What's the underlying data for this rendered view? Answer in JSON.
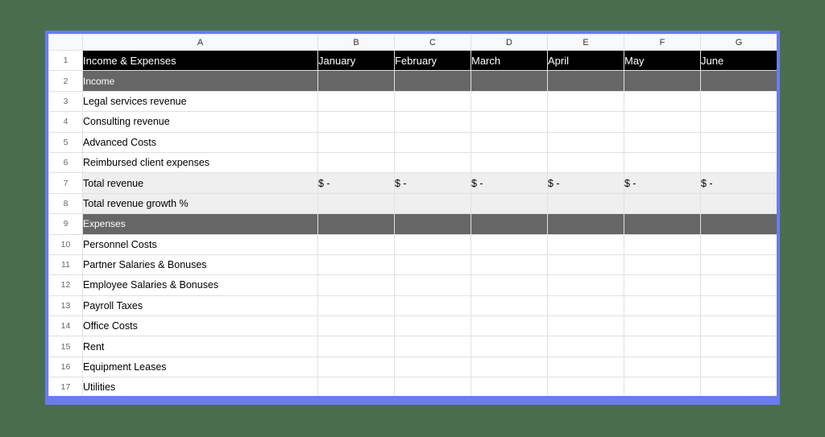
{
  "app": {
    "background_color": "#4a6e4d",
    "frame_border_color": "#6b7bf0"
  },
  "spreadsheet": {
    "column_headers": [
      "A",
      "B",
      "C",
      "D",
      "E",
      "F",
      "G"
    ],
    "corner_label": "",
    "colors": {
      "title_row_bg": "#000000",
      "section_row_bg": "#666666",
      "total_row_bg": "#efefef",
      "gridline": "#e0e0e3",
      "header_strip_bg": "#f8f9fa"
    },
    "months": [
      "January",
      "February",
      "March",
      "April",
      "May",
      "June"
    ],
    "rows": [
      {
        "num": "1",
        "label": "Income & Expenses",
        "style": "title",
        "merged": false,
        "values": [
          "January",
          "February",
          "March",
          "April",
          "May",
          "June"
        ]
      },
      {
        "num": "2",
        "label": "Income",
        "style": "section",
        "merged": true,
        "values": [
          "",
          "",
          "",
          "",
          "",
          ""
        ]
      },
      {
        "num": "3",
        "label": "Legal services revenue",
        "style": "normal",
        "merged": false,
        "values": [
          "",
          "",
          "",
          "",
          "",
          ""
        ]
      },
      {
        "num": "4",
        "label": "Consulting revenue",
        "style": "normal",
        "merged": false,
        "values": [
          "",
          "",
          "",
          "",
          "",
          ""
        ]
      },
      {
        "num": "5",
        "label": "Advanced Costs",
        "style": "group",
        "merged": false,
        "values": [
          "",
          "",
          "",
          "",
          "",
          ""
        ]
      },
      {
        "num": "6",
        "label": "Reimbursed client expenses",
        "style": "normal",
        "merged": false,
        "values": [
          "",
          "",
          "",
          "",
          "",
          ""
        ]
      },
      {
        "num": "7",
        "label": "Total revenue",
        "style": "total",
        "merged": false,
        "values": [
          "$ -",
          "$ -",
          "$ -",
          "$ -",
          "$ -",
          "$ -"
        ]
      },
      {
        "num": "8",
        "label": "Total revenue growth %",
        "style": "total",
        "merged": false,
        "values": [
          "",
          "",
          "",
          "",
          "",
          ""
        ]
      },
      {
        "num": "9",
        "label": "Expenses",
        "style": "section",
        "merged": true,
        "values": [
          "",
          "",
          "",
          "",
          "",
          ""
        ]
      },
      {
        "num": "10",
        "label": "Personnel Costs",
        "style": "group",
        "merged": true,
        "values": [
          "",
          "",
          "",
          "",
          "",
          ""
        ]
      },
      {
        "num": "11",
        "label": "Partner Salaries & Bonuses",
        "style": "normal",
        "merged": false,
        "values": [
          "",
          "",
          "",
          "",
          "",
          ""
        ]
      },
      {
        "num": "12",
        "label": "Employee Salaries & Bonuses",
        "style": "normal",
        "merged": false,
        "values": [
          "",
          "",
          "",
          "",
          "",
          ""
        ]
      },
      {
        "num": "13",
        "label": "Payroll Taxes",
        "style": "normal",
        "merged": false,
        "values": [
          "",
          "",
          "",
          "",
          "",
          ""
        ]
      },
      {
        "num": "14",
        "label": "Office Costs",
        "style": "group",
        "merged": true,
        "values": [
          "",
          "",
          "",
          "",
          "",
          ""
        ]
      },
      {
        "num": "15",
        "label": "Rent",
        "style": "normal",
        "merged": false,
        "values": [
          "",
          "",
          "",
          "",
          "",
          ""
        ]
      },
      {
        "num": "16",
        "label": "Equipment Leases",
        "style": "normal",
        "merged": false,
        "values": [
          "",
          "",
          "",
          "",
          "",
          ""
        ]
      },
      {
        "num": "17",
        "label": "Utilities",
        "style": "normal",
        "merged": false,
        "values": [
          "",
          "",
          "",
          "",
          "",
          ""
        ]
      }
    ]
  }
}
